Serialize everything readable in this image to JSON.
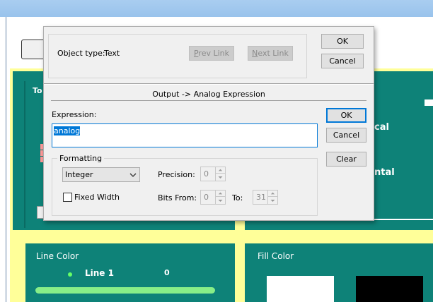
{
  "background": {
    "panel_title_fragment": "To",
    "right_text_1": "cal",
    "right_text_2": "ntal",
    "line_color_label": "Line Color",
    "fill_color_label": "Fill Color",
    "line1_label": "Line 1",
    "line1_value": "0",
    "colors": {
      "teal": "#0e8278",
      "yellow": "#ffff99",
      "line1_green": "#88ee88"
    }
  },
  "dialog": {
    "object_type_label": "Object type:",
    "object_type_value": "Text",
    "prev_link_label": "Prev Link",
    "next_link_label": "Next Link",
    "ok_top_label": "OK",
    "cancel_top_label": "Cancel",
    "subtitle": "Output -> Analog Expression",
    "expression_label": "Expression:",
    "expression_value": "analog",
    "ok_label": "OK",
    "cancel_label": "Cancel",
    "clear_label": "Clear",
    "formatting": {
      "legend": "Formatting",
      "format_selected": "Integer",
      "fixed_width_label": "Fixed Width",
      "fixed_width_checked": false,
      "precision_label": "Precision:",
      "precision_value": "0",
      "bits_from_label": "Bits From:",
      "bits_from_value": "0",
      "to_label": "To:",
      "to_value": "31"
    },
    "accent_color": "#0078d7"
  }
}
